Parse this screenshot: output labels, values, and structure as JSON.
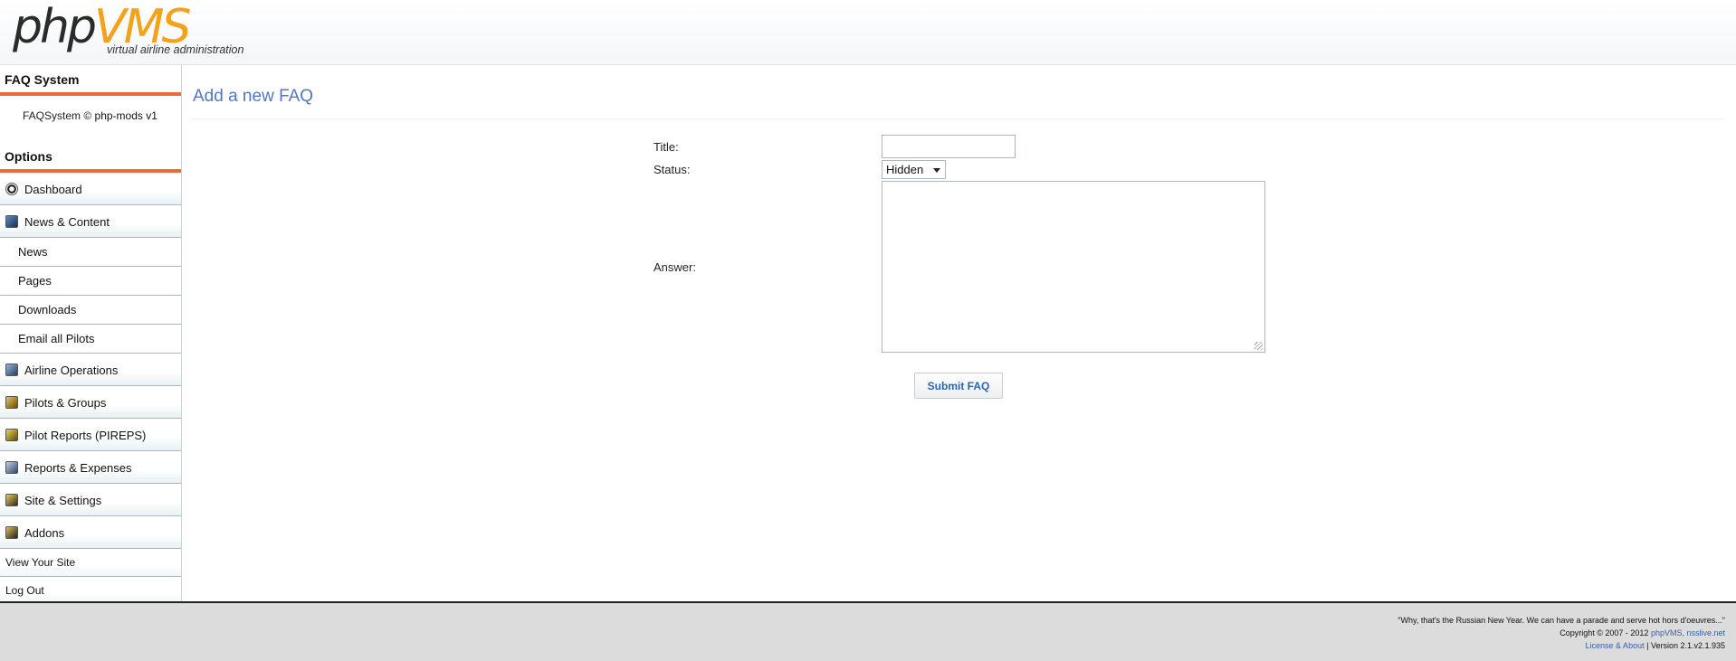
{
  "header": {
    "logo_php": "php",
    "logo_vms": "VMS",
    "logo_tagline": "virtual airline administration"
  },
  "sidebar": {
    "faq_section_title": "FAQ System",
    "faq_credit_prefix": "FAQSystem © ",
    "faq_credit_mods": "php-mods v1",
    "options_section_title": "Options",
    "items": [
      {
        "label": "Dashboard",
        "icon": "dashboard-icon"
      },
      {
        "label": "News & Content",
        "icon": "news-icon"
      },
      {
        "label": "News"
      },
      {
        "label": "Pages"
      },
      {
        "label": "Downloads"
      },
      {
        "label": "Email all Pilots"
      },
      {
        "label": "Airline Operations",
        "icon": "airline-icon"
      },
      {
        "label": "Pilots & Groups",
        "icon": "pilots-icon"
      },
      {
        "label": "Pilot Reports (PIREPS)",
        "icon": "pireps-icon"
      },
      {
        "label": "Reports & Expenses",
        "icon": "reports-icon"
      },
      {
        "label": "Site & Settings",
        "icon": "settings-icon"
      },
      {
        "label": "Addons",
        "icon": "addons-icon"
      },
      {
        "label": "View Your Site"
      },
      {
        "label": "Log Out"
      }
    ]
  },
  "main": {
    "page_title": "Add a new FAQ",
    "form": {
      "title_label": "Title:",
      "title_value": "",
      "status_label": "Status:",
      "status_selected": "Hidden",
      "answer_label": "Answer:",
      "answer_value": "",
      "submit_label": "Submit FAQ"
    }
  },
  "footer": {
    "quote": "\"Why, that's the Russian New Year. We can have a parade and serve hot hors d'oeuvres...\"",
    "copyright_prefix": "Copyright © 2007 - 2012 ",
    "copyright_links": "phpVMS, nsslive.net",
    "license": "License & About",
    "version": "Version 2.1.v2.1.935"
  },
  "colors": {
    "accent_orange": "#e96a3a",
    "title_blue": "#4f78c4",
    "logo_orange": "#f4a11c",
    "button_text": "#2c64b4"
  }
}
